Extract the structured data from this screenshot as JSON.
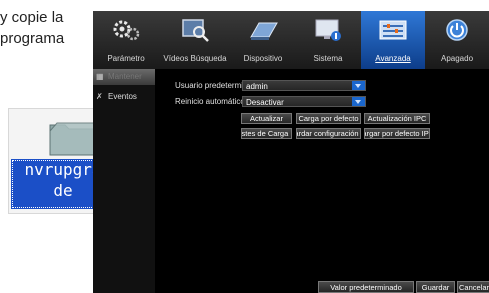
{
  "document": {
    "line1": "y copie la",
    "line2": "programa",
    "folder_label_line1": "nvrupgra",
    "folder_label_line2": "de"
  },
  "topbar": {
    "tabs": [
      {
        "label": "Parámetro",
        "icon": "gears-icon"
      },
      {
        "label": "Vídeos Búsqueda",
        "icon": "video-search-icon"
      },
      {
        "label": "Dispositivo",
        "icon": "hard-drive-icon"
      },
      {
        "label": "Sistema",
        "icon": "system-info-icon"
      },
      {
        "label": "Avanzada",
        "icon": "advanced-panel-icon",
        "active": true
      },
      {
        "label": "Apagado",
        "icon": "power-icon"
      }
    ]
  },
  "sidebar": {
    "items": [
      {
        "label": "Mantener",
        "icon": "maintain-icon",
        "active": true
      },
      {
        "label": "Eventos",
        "icon": "tools-icon"
      }
    ]
  },
  "main": {
    "default_user_label": "Usuario predetermi",
    "default_user_value": "admin",
    "auto_restart_label": "Reinicio automático",
    "auto_restart_value": "Desactivar",
    "buttons": {
      "update": "Actualizar",
      "load_default": "Carga por defecto",
      "ipc_update": "Actualización IPC",
      "load_settings": "Ajustes de Carga",
      "save_settings": "Guardar configuración",
      "ipc_load_default": "Cargar por defecto IPC"
    }
  },
  "footer": {
    "default_value": "Valor predeterminado",
    "save": "Guardar",
    "cancel": "Cancelar"
  },
  "colors": {
    "active_tab": "#1f63c4",
    "dropdown_arrow": "#1a66cc",
    "folder_label_bg": "#1b4fc7"
  }
}
